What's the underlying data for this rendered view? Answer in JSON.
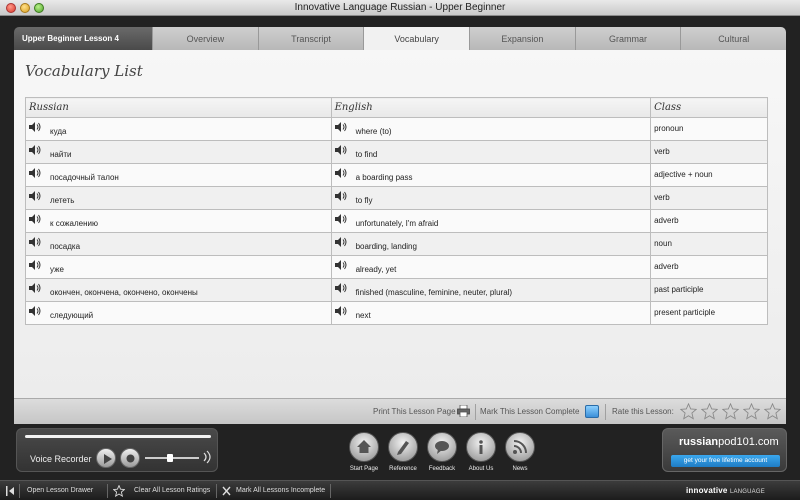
{
  "window": {
    "title": "Innovative Language Russian - Upper Beginner"
  },
  "tabs": {
    "lesson_label": "Upper Beginner Lesson 4",
    "items": [
      "Overview",
      "Transcript",
      "Vocabulary",
      "Expansion",
      "Grammar",
      "Cultural"
    ],
    "active": "Vocabulary"
  },
  "page": {
    "title": "Vocabulary List"
  },
  "table": {
    "headers": [
      "Russian",
      "English",
      "Class"
    ],
    "rows": [
      {
        "ru": "куда",
        "en": "where (to)",
        "cls": "pronoun"
      },
      {
        "ru": "найти",
        "en": "to find",
        "cls": "verb"
      },
      {
        "ru": "посадочный талон",
        "en": "a boarding pass",
        "cls": "adjective + noun"
      },
      {
        "ru": "лететь",
        "en": "to fly",
        "cls": "verb"
      },
      {
        "ru": "к сожалению",
        "en": "unfortunately, I'm afraid",
        "cls": "adverb"
      },
      {
        "ru": "посадка",
        "en": "boarding, landing",
        "cls": "noun"
      },
      {
        "ru": "уже",
        "en": "already, yet",
        "cls": "adverb"
      },
      {
        "ru": "окончен, окончена, окончено, окончены",
        "en": "finished (masculine, feminine, neuter, plural)",
        "cls": "past participle"
      },
      {
        "ru": "следующий",
        "en": "next",
        "cls": "present participle"
      }
    ]
  },
  "footer": {
    "print_label": "Print This Lesson Page",
    "complete_label": "Mark This Lesson Complete",
    "rate_label": "Rate this Lesson:"
  },
  "recorder": {
    "label": "Voice Recorder"
  },
  "nav": {
    "start": "Start Page",
    "reference": "Reference",
    "feedback": "Feedback",
    "about": "About Us",
    "news": "News"
  },
  "promo": {
    "brand_bold": "russian",
    "brand_rest": "pod101.com",
    "button": "get your free lifetime account"
  },
  "statusbar": {
    "open_drawer": "Open Lesson Drawer",
    "clear_ratings": "Clear All Lesson Ratings",
    "mark_incomplete": "Mark All Lessons Incomplete",
    "brand_bold": "innovative",
    "brand_rest": "LANGUAGE"
  },
  "colors": {
    "accent": "#2f8ee0",
    "panel": "#f2f2f2",
    "chrome": "#222222"
  }
}
